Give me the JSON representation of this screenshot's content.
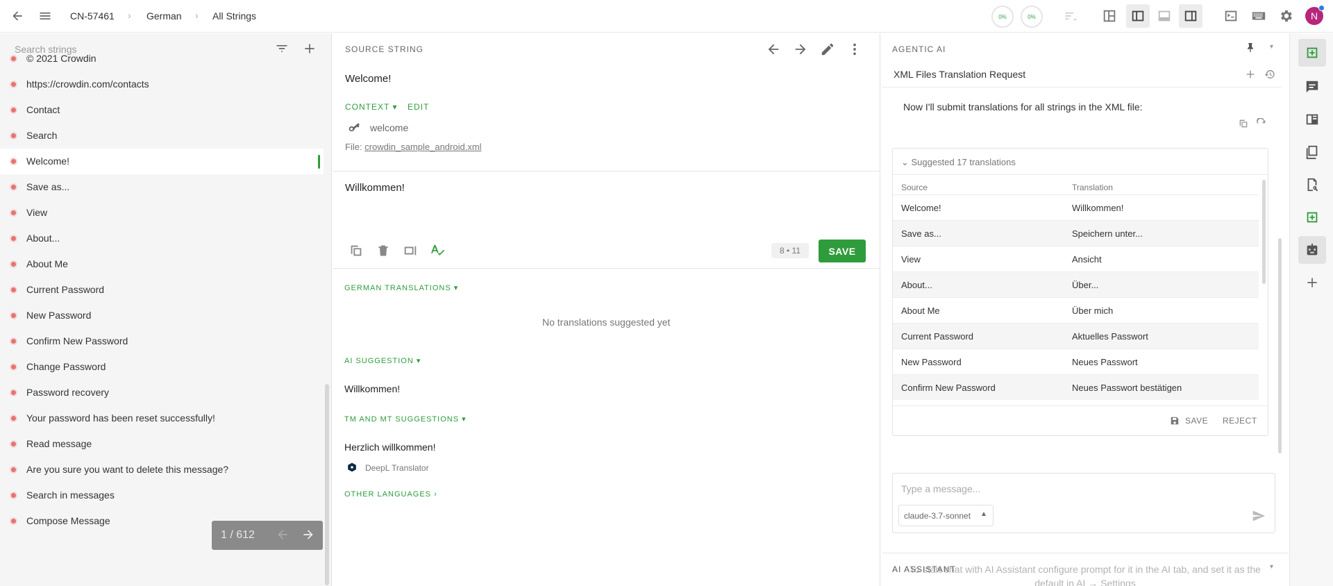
{
  "topbar": {
    "breadcrumb": [
      "CN-57461",
      "German",
      "All Strings"
    ],
    "progress": [
      "0%",
      "0%"
    ],
    "avatar_initial": "N"
  },
  "left": {
    "search_placeholder": "Search strings",
    "items": [
      "© 2021 Crowdin",
      "https://crowdin.com/contacts",
      "Contact",
      "Search",
      "Welcome!",
      "Save as...",
      "View",
      "About...",
      "About Me",
      "Current Password",
      "New Password",
      "Confirm New Password",
      "Change Password",
      "Password recovery",
      "Your password has been reset successfully!",
      "Read message",
      "Are you sure you want to delete this message?",
      "Search in messages",
      "Compose Message"
    ],
    "pager": "1 / 612"
  },
  "mid": {
    "source_label": "SOURCE STRING",
    "source_text": "Welcome!",
    "context_label": "CONTEXT",
    "edit_label": "EDIT",
    "key": "welcome",
    "file_prefix": "File: ",
    "file_name": "crowdin_sample_android.xml",
    "translation": "Willkommen!",
    "counter": "8 • 11",
    "save": "SAVE",
    "german_translations": "GERMAN TRANSLATIONS",
    "no_translations": "No translations suggested yet",
    "ai_suggestion": "AI SUGGESTION",
    "ai_text": "Willkommen!",
    "tm_mt": "TM AND MT SUGGESTIONS",
    "tm_text": "Herzlich willkommen!",
    "tm_source": "DeepL Translator",
    "other_languages": "OTHER LANGUAGES"
  },
  "right": {
    "header": "AGENTIC AI",
    "chat_title": "XML Files Translation Request",
    "message": "Now I'll submit translations for all strings in the XML file:",
    "suggested": "Suggested 17 translations",
    "col_source": "Source",
    "col_translation": "Translation",
    "rows": [
      {
        "s": "Welcome!",
        "t": "Willkommen!"
      },
      {
        "s": "Save as...",
        "t": "Speichern unter..."
      },
      {
        "s": "View",
        "t": "Ansicht"
      },
      {
        "s": "About...",
        "t": "Über..."
      },
      {
        "s": "About Me",
        "t": "Über mich"
      },
      {
        "s": "Current Password",
        "t": "Aktuelles Passwort"
      },
      {
        "s": "New Password",
        "t": "Neues Passwort"
      },
      {
        "s": "Confirm New Password",
        "t": "Neues Passwort bestätigen"
      }
    ],
    "save": "SAVE",
    "reject": "REJECT",
    "input_placeholder": "Type a message...",
    "model": "claude-3.7-sonnet",
    "ai_assistant": "AI ASSISTANT",
    "overlay_text": "To start chat with AI Assistant configure prompt for it in the AI tab, and set it as the default in AI → Settings"
  }
}
